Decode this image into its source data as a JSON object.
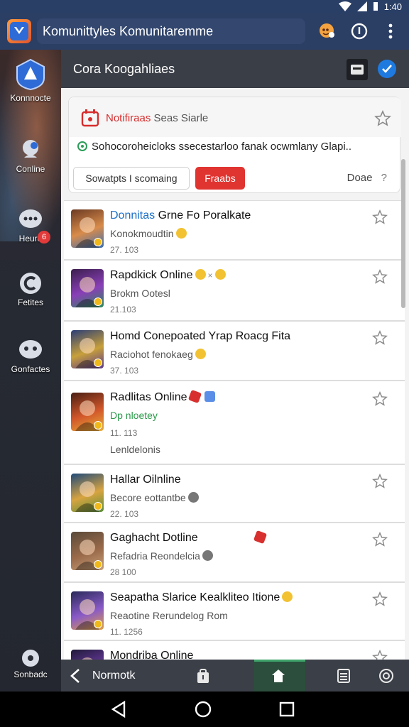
{
  "status_bar": {
    "time": "1:40"
  },
  "app_bar": {
    "title": "Komunittyles Komunitaremme",
    "logo_icon": "shield-logo",
    "actions": [
      "chat-bubble-icon",
      "info-icon",
      "more-vert-icon"
    ]
  },
  "sidebar": {
    "items": [
      {
        "label": "Konnnocte",
        "icon": "shield-logo-icon"
      },
      {
        "label": "Conline",
        "icon": "chat-people-icon"
      },
      {
        "label": "Heure",
        "icon": "chat-bubbles-icon",
        "badge": "6"
      },
      {
        "label": "Fetites",
        "icon": "c-logo-icon"
      },
      {
        "label": "Gonfactes",
        "icon": "group-chat-icon"
      },
      {
        "label": "Sonbadc",
        "icon": "settings-icon"
      }
    ]
  },
  "header": {
    "title": "Cora Koogahliaes"
  },
  "notification": {
    "title_red": "Notifiraas",
    "title_grey": "Seas Siarle",
    "description": "Sohocoroheicloks ssecestarloo fanak ocwmlany Glapi..",
    "button_outline": "Sowatpts  I scomaing",
    "button_red": "Fraabs",
    "done_label": "Doae",
    "done_suffix": "?"
  },
  "list": [
    {
      "title_highlight": "Donnitas",
      "title_rest": " Grne Fo Poralkate",
      "subtitle": "Konokmoudtin",
      "meta": "27. 103",
      "colors": [
        "#6b3a22",
        "#d98c4a",
        "#3a6fb5"
      ]
    },
    {
      "title_highlight": "",
      "title_rest": "Rapdkick  Online",
      "subtitle": "Brokm Ootesl",
      "meta": "21.103",
      "colors": [
        "#3b1e4d",
        "#8a3fb8",
        "#2a8c5a"
      ]
    },
    {
      "title_highlight": "",
      "title_rest": "Homd Conepoated Yrap Roacg Fita",
      "subtitle": "Raciohot fenokaeg",
      "meta": "37. 103",
      "colors": [
        "#2b3e75",
        "#c8a03a",
        "#5b3a8c"
      ]
    },
    {
      "title_highlight": "",
      "title_rest": "Radlitas  Online",
      "subtitle": "Dp nloetey",
      "meta": "11. 113",
      "extra": "Lenldelonis",
      "colors": [
        "#4a1f14",
        "#d2572a",
        "#e8b03a"
      ]
    },
    {
      "title_highlight": "",
      "title_rest": "Hallar Oilnline",
      "subtitle": "Becore eottantbe",
      "meta": "22. 103",
      "colors": [
        "#1f4a7a",
        "#d8a440",
        "#5a8c3a"
      ]
    },
    {
      "title_highlight": "",
      "title_rest": "Gaghacht  Dotline",
      "subtitle": "Refadria Reondelcia",
      "meta": "28 100",
      "colors": [
        "#5a4a3a",
        "#9a6a4a",
        "#c8a07a"
      ]
    },
    {
      "title_highlight": "",
      "title_rest": "Seapatha  Slarice Kealkliteo Itione",
      "subtitle": "Reaotine Rerundelog",
      "subtitle_extra": "Rom",
      "meta": "11. 1256",
      "colors": [
        "#2a2a5a",
        "#8a5ac8",
        "#e0a040"
      ]
    },
    {
      "title_highlight": "",
      "title_rest": "Mondriba  Online",
      "subtitle": "",
      "meta": "",
      "colors": [
        "#201a3a",
        "#6a3aa0",
        "#3a5ab8"
      ]
    }
  ],
  "bottom_bar": {
    "back_label": "Normotk",
    "buttons": [
      "bag-icon",
      "home-icon",
      "document-icon",
      "circle-target-icon"
    ],
    "active": "home-icon"
  },
  "system_nav": [
    "back-triangle-icon",
    "home-circle-icon",
    "recents-square-icon"
  ]
}
